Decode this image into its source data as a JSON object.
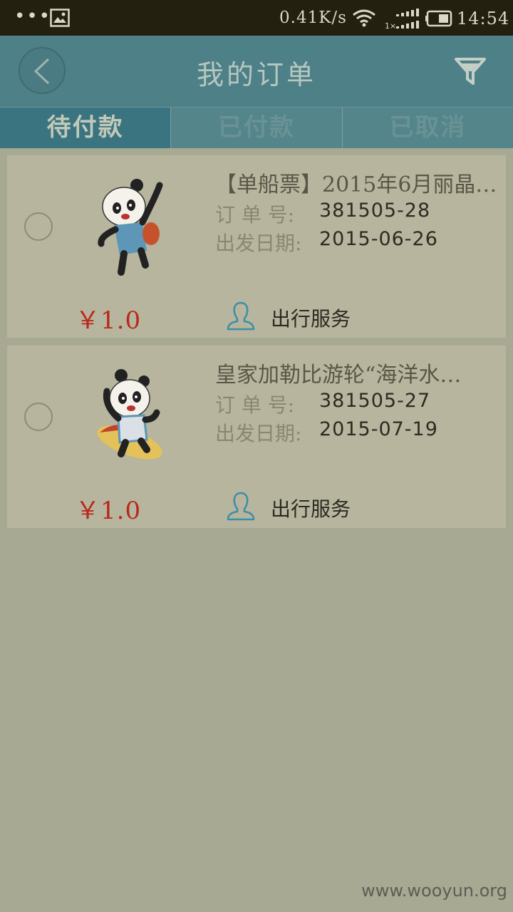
{
  "status_bar": {
    "dots": "•••",
    "speed": "0.41K/s",
    "network_badge": "1×",
    "time": "14:54"
  },
  "header": {
    "title": "我的订单",
    "back_icon": "chevron-left-icon",
    "filter_icon": "filter-icon"
  },
  "tabs": [
    {
      "label": "待付款",
      "active": true
    },
    {
      "label": "已付款",
      "active": false
    },
    {
      "label": "已取消",
      "active": false
    }
  ],
  "orders": [
    {
      "title": "【单船票】2015年6月丽晶…",
      "order_no_label": "订 单 号:",
      "order_no": "381505-28",
      "date_label": "出发日期:",
      "date": "2015-06-26",
      "price": "￥1.0",
      "service_label": "出行服务",
      "image": "panda-backpack-icon"
    },
    {
      "title": "皇家加勒比游轮“海洋水…",
      "order_no_label": "订 单 号:",
      "order_no": "381505-27",
      "date_label": "出发日期:",
      "date": "2015-07-19",
      "price": "￥1.0",
      "service_label": "出行服务",
      "image": "panda-surfboard-icon"
    }
  ],
  "watermark": "www.wooyun.org",
  "colors": {
    "header": "#4e8087",
    "active_tab": "#3a7481",
    "price": "#b8281c",
    "background": "#a8a993",
    "card": "#b7b59e"
  }
}
